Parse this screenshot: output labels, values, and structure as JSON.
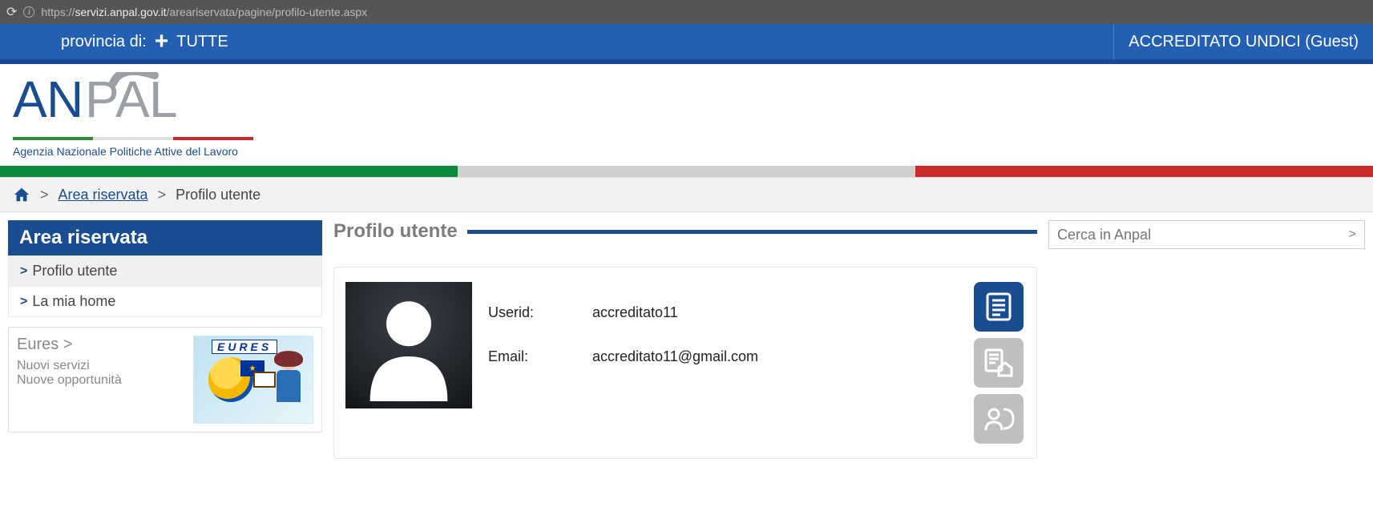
{
  "browser": {
    "url_prefix": "https://",
    "url_domain": "servizi.anpal.gov.it",
    "url_path": "/areariservata/pagine/profilo-utente.aspx"
  },
  "topbar": {
    "provincia_label": "provincia di:",
    "provincia_value": "TUTTE",
    "user_text": "ACCREDITATO UNDICI (Guest)"
  },
  "logo": {
    "subtitle": "Agenzia Nazionale Politiche Attive del Lavoro"
  },
  "breadcrumb": {
    "area": "Area riservata",
    "current": "Profilo utente"
  },
  "sidebar": {
    "header": "Area riservata",
    "items": [
      {
        "label": "Profilo utente"
      },
      {
        "label": "La mia home"
      }
    ],
    "eures": {
      "title": "Eures >",
      "line1": "Nuovi servizi",
      "line2": "Nuove opportunità",
      "logo_text": "EURES"
    }
  },
  "content": {
    "heading": "Profilo utente",
    "fields": {
      "userid_label": "Userid:",
      "userid_value": "accreditato11",
      "email_label": "Email:",
      "email_value": "accreditato11@gmail.com"
    }
  },
  "search": {
    "placeholder": "Cerca in Anpal",
    "go": ">"
  }
}
